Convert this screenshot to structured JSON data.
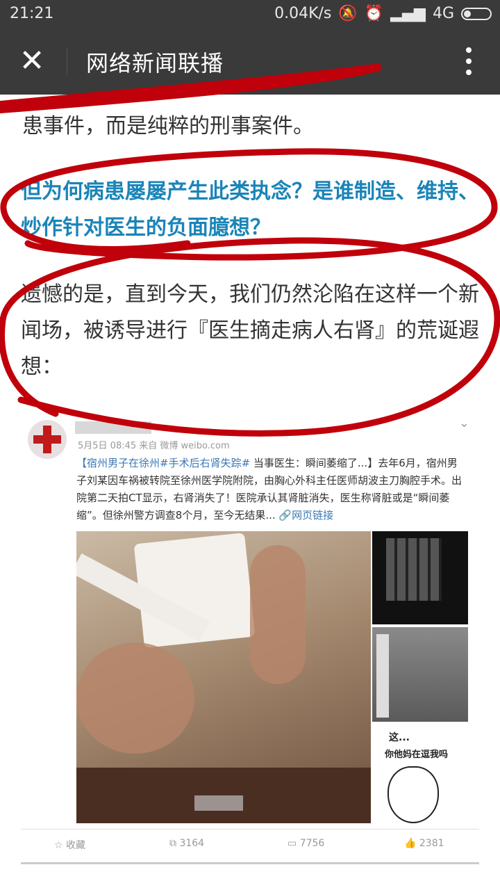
{
  "status_bar": {
    "time": "21:21",
    "net_speed": "0.04K/s",
    "network": "4G"
  },
  "header": {
    "title": "网络新闻联播"
  },
  "article": {
    "para_top": "患事件，而是纯粹的刑事案件。",
    "question": "但为何病患屡屡产生此类执念？是谁制造、维持、炒作针对医生的负面臆想？",
    "para_main": "遗憾的是，直到今天，我们仍然沦陷在这样一个新闻场，被诱导进行『医生摘走病人右肾』的荒诞遐想："
  },
  "weibo_card": {
    "meta": "5月5日 08:45 来自 微博 weibo.com",
    "text_tag": "【宿州男子在徐州#手术后右肾失踪#",
    "text_body": " 当事医生：瞬间萎缩了...】去年6月，宿州男子刘某因车祸被转院至徐州医学院附院，由胸心外科主任医师胡波主刀胸腔手术。出院第二天拍CT显示，右肾消失了！医院承认其肾脏消失，医生称肾脏或是“瞬间萎缩”。但徐州警方调查8个月，至今无结果...",
    "link": "网页链接",
    "meme_line1": "这...",
    "meme_line2": "你他妈在逗我吗",
    "actions": {
      "favorite": "收藏",
      "repost_count": "3164",
      "comment_count": "7756",
      "like_count": "2381"
    }
  },
  "colors": {
    "bar_bg": "#3a3a3a",
    "question_blue": "#1a84b8",
    "annotation_red": "#c0000a"
  }
}
